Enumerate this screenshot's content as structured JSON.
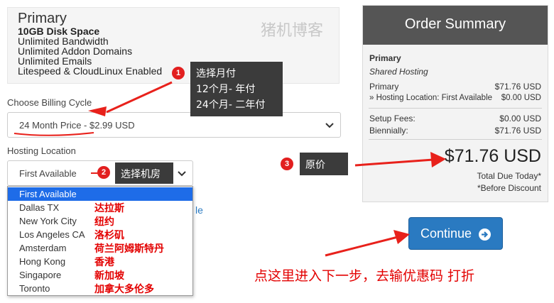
{
  "product": {
    "name": "Primary",
    "features": [
      "10GB Disk Space",
      "Unlimited Bandwidth",
      "Unlimited Addon Domains",
      "Unlimited Emails",
      "Litespeed & CloudLinux Enabled"
    ],
    "watermark": "猪机博客"
  },
  "billing": {
    "label": "Choose Billing Cycle",
    "selected": "24 Month Price - $2.99 USD"
  },
  "location": {
    "label": "Hosting Location",
    "selected": "First Available",
    "options": [
      "First Available",
      "Dallas TX",
      "New York City",
      "Los Angeles CA",
      "Amsterdam",
      "Hong Kong",
      "Singapore",
      "Toronto"
    ],
    "notes": [
      "达拉斯",
      "纽约",
      "洛杉矶",
      "荷兰阿姆斯特丹",
      "香港",
      "新加坡",
      "加拿大多伦多"
    ],
    "partial_text": "le"
  },
  "annotations": {
    "step1_num": "1",
    "step1_lines": [
      "选择月付",
      "12个月- 年付",
      "24个月- 二年付"
    ],
    "step2_num": "2",
    "step2_text": "选择机房",
    "step3_num": "3",
    "step3_text": "原价",
    "bottom_text": "点这里进入下一步，去输优惠码 打折",
    "arrow_color": "#e8211b"
  },
  "summary": {
    "title": "Order Summary",
    "product_name": "Primary",
    "product_group": "Shared Hosting",
    "line1_label": "Primary",
    "line1_value": "$71.76 USD",
    "line2_label": "» Hosting Location: First Available",
    "line2_value": "$0.00 USD",
    "setup_label": "Setup Fees:",
    "setup_value": "$0.00 USD",
    "cycle_label": "Biennially:",
    "cycle_value": "$71.76 USD",
    "total": "$71.76 USD",
    "total_caption": "Total Due Today*",
    "footnote": "*Before Discount"
  },
  "actions": {
    "continue_label": "Continue"
  }
}
